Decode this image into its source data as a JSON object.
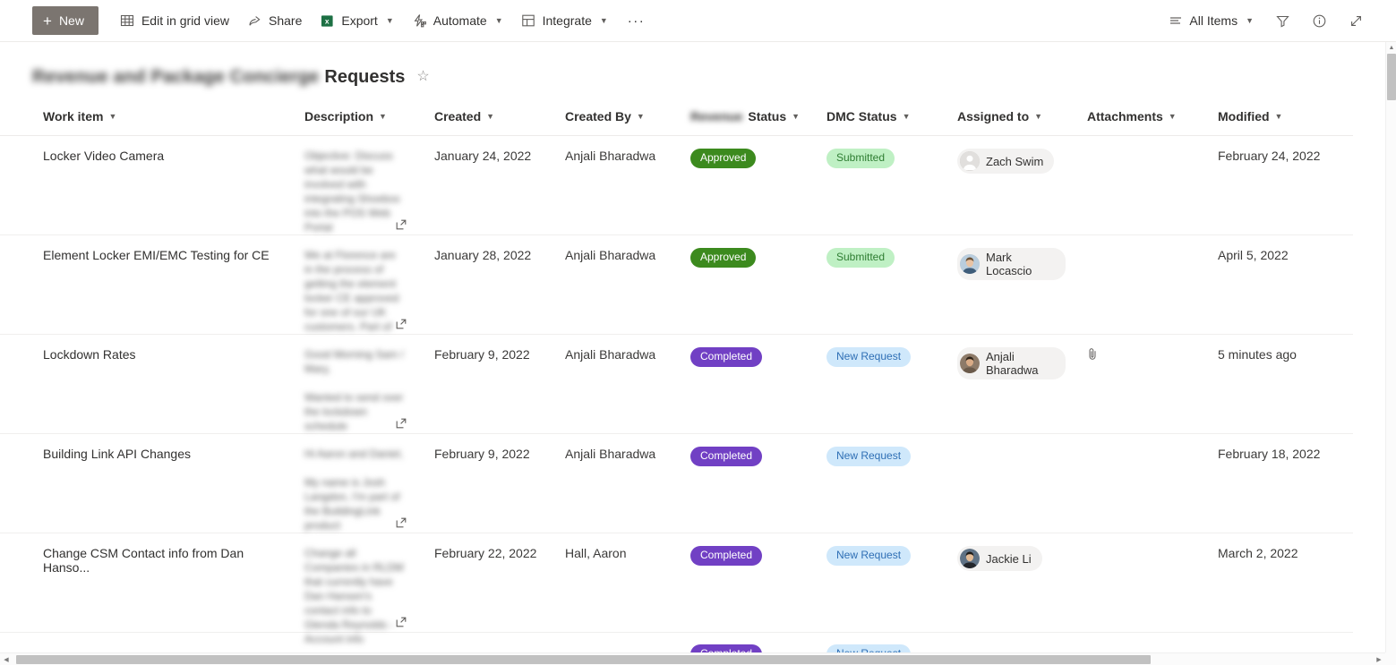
{
  "commandbar": {
    "new_label": "New",
    "items": [
      {
        "label": "Edit in grid view",
        "icon": "grid-icon",
        "caret": false
      },
      {
        "label": "Share",
        "icon": "share-icon",
        "caret": false
      },
      {
        "label": "Export",
        "icon": "excel-icon",
        "caret": true
      },
      {
        "label": "Automate",
        "icon": "automate-icon",
        "caret": true
      },
      {
        "label": "Integrate",
        "icon": "integrate-icon",
        "caret": true
      }
    ],
    "overflow_label": "···",
    "view_label": "All Items",
    "right_icons": [
      "filter-icon",
      "info-icon",
      "expand-icon"
    ]
  },
  "header": {
    "title_blurred": "Revenue and Package Concierge",
    "title": "Requests",
    "favorite_icon": "star-icon"
  },
  "columns": [
    {
      "label": "Work item",
      "blurred_prefix": ""
    },
    {
      "label": "Description",
      "blurred_prefix": ""
    },
    {
      "label": "Created",
      "blurred_prefix": ""
    },
    {
      "label": "Created By",
      "blurred_prefix": ""
    },
    {
      "label": "Status",
      "blurred_prefix": "Revenue"
    },
    {
      "label": "DMC Status",
      "blurred_prefix": ""
    },
    {
      "label": "Assigned to",
      "blurred_prefix": ""
    },
    {
      "label": "Attachments",
      "blurred_prefix": ""
    },
    {
      "label": "Modified",
      "blurred_prefix": ""
    }
  ],
  "rows": [
    {
      "work_item": "Locker Video Camera",
      "description_blurred": "Objective: Discuss what would be involved with integrating Shoebox into the POS Web Portal",
      "created": "January 24, 2022",
      "created_by": "Anjali Bharadwa",
      "status": "Approved",
      "dmc_status": "Submitted",
      "assigned_to": "Zach Swim",
      "avatar_kind": "silhouette",
      "attachment": false,
      "modified": "February 24, 2022"
    },
    {
      "work_item": "Element Locker EMI/EMC Testing for CE",
      "description_blurred": "We at Florence are in the process of getting the element locker CE approved for one of our UK customers. Part of",
      "created": "January 28, 2022",
      "created_by": "Anjali Bharadwa",
      "status": "Approved",
      "dmc_status": "Submitted",
      "assigned_to": "Mark Locascio",
      "avatar_kind": "photo-mark",
      "attachment": false,
      "modified": "April 5, 2022"
    },
    {
      "work_item": "Lockdown Rates",
      "description_blurred": "Good Morning Sam / Mary,\n\nWanted to send over the lockdown schedule",
      "created": "February 9, 2022",
      "created_by": "Anjali Bharadwa",
      "status": "Completed",
      "dmc_status": "New Request",
      "assigned_to": "Anjali Bharadwa",
      "avatar_kind": "photo-anjali",
      "attachment": true,
      "modified": "5 minutes ago"
    },
    {
      "work_item": "Building Link API Changes",
      "description_blurred": "Hi Aaron and Daniel,\n\nMy name is Josh Langdon, I'm part of the BuildingLink product",
      "created": "February 9, 2022",
      "created_by": "Anjali Bharadwa",
      "status": "Completed",
      "dmc_status": "New Request",
      "assigned_to": "",
      "avatar_kind": "none",
      "attachment": false,
      "modified": "February 18, 2022"
    },
    {
      "work_item": "Change CSM Contact info from Dan Hanso...",
      "description_blurred": "Change all Companies in RLDM that currently have Dan Hansen's contact info to Glenda Reynolds - Account info",
      "created": "February 22, 2022",
      "created_by": "Hall, Aaron",
      "status": "Completed",
      "dmc_status": "New Request",
      "assigned_to": "Jackie Li",
      "avatar_kind": "photo-jackie",
      "attachment": false,
      "modified": "March 2, 2022"
    },
    {
      "work_item": "",
      "description_blurred": "",
      "created": "",
      "created_by": "",
      "status": "Completed",
      "dmc_status": "New Request",
      "assigned_to": "",
      "avatar_kind": "partial",
      "attachment": false,
      "modified": ""
    }
  ],
  "status_colors": {
    "Approved": {
      "bg": "#3c8a1e",
      "fg": "#ffffff"
    },
    "Completed": {
      "bg": "#7140c4",
      "fg": "#ffffff"
    },
    "Submitted": {
      "bg": "#bff0c4",
      "fg": "#2e7d32"
    },
    "New Request": {
      "bg": "#cfe8fb",
      "fg": "#2f6fb5"
    }
  },
  "theme": {
    "new_button_bg": "#7b7570",
    "excel_green": "#1d7044",
    "border": "#edebe9",
    "text": "#323130"
  }
}
